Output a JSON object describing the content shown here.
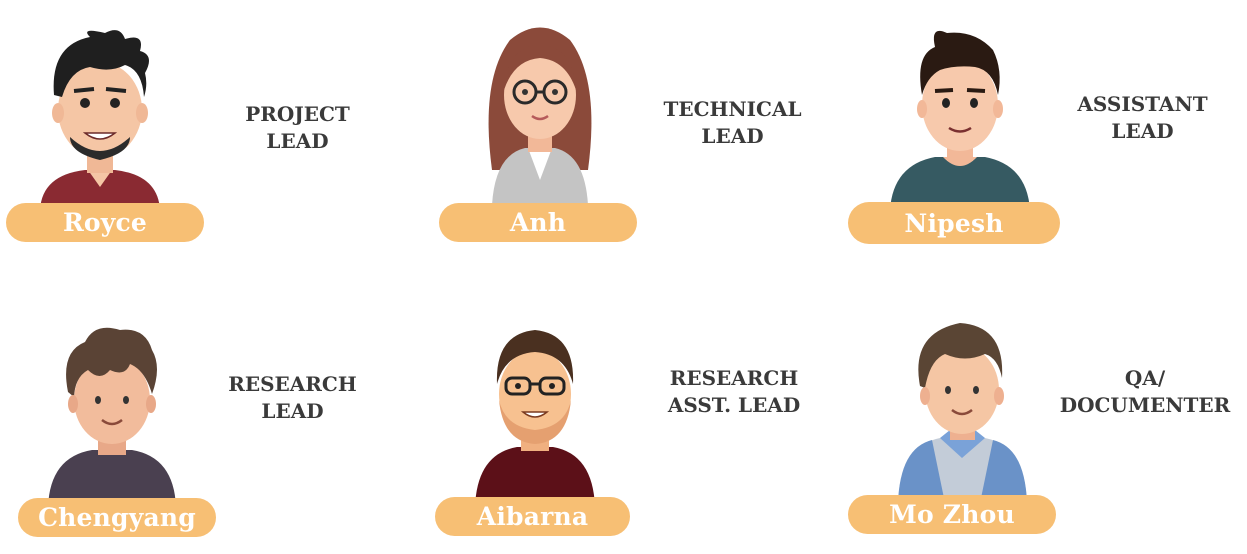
{
  "members": [
    {
      "name": "Royce",
      "role_lines": [
        "PROJECT",
        "LEAD"
      ],
      "avatar_icon": "man-spiky-black-hair-red-shirt-icon"
    },
    {
      "name": "Anh",
      "role_lines": [
        "TECHNICAL",
        "LEAD"
      ],
      "avatar_icon": "woman-glasses-long-brown-hair-icon"
    },
    {
      "name": "Nipesh",
      "role_lines": [
        "ASSISTANT",
        "LEAD"
      ],
      "avatar_icon": "man-quiff-dark-hair-teal-shirt-icon"
    },
    {
      "name": "Chengyang",
      "role_lines": [
        "RESEARCH",
        "LEAD"
      ],
      "avatar_icon": "man-curly-brown-hair-icon"
    },
    {
      "name": "Aibarna",
      "role_lines": [
        "RESEARCH",
        "ASST. LEAD"
      ],
      "avatar_icon": "man-glasses-beard-maroon-shirt-icon"
    },
    {
      "name": "Mo Zhou",
      "role_lines": [
        "QA/",
        "DOCUMENTER"
      ],
      "avatar_icon": "man-brown-hair-blue-vest-icon"
    }
  ],
  "colors": {
    "nametag": "#f7bf74",
    "nametag_text": "#ffffff",
    "role_text": "#3a3a3a",
    "background": "#ffffff"
  }
}
